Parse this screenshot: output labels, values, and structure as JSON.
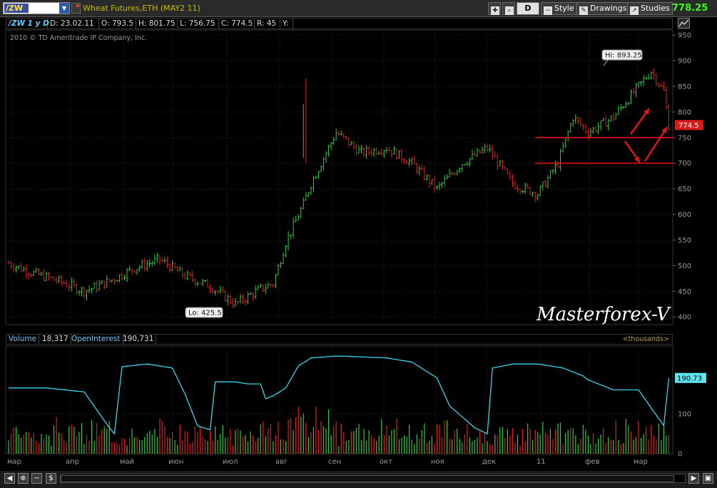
{
  "toolbar": {
    "symbol": "/ZW",
    "title": "Wheat Futures,ETH (MAY2 11)",
    "period_button": "D",
    "style_label": "Style",
    "drawings_label": "Drawings",
    "studies_label": "Studies",
    "last_price": "778.25"
  },
  "info_bar": {
    "symbol_period": "/ZW 1 y D",
    "date": "D: 23.02.11",
    "open": "O: 793.5",
    "high": "H: 801.75",
    "low": "L: 756.75",
    "close": "C: 774.5",
    "range": "R: 45",
    "y": "Y:"
  },
  "copyright": "2010 © TD Ameritrade IP Company, Inc.",
  "annotations": {
    "hi": "Hi: 893.25",
    "lo": "Lo: 425.5",
    "current_price_tag": "774.5",
    "watermark": "Masterforex-V"
  },
  "volume_bar": {
    "volume_label": "Volume",
    "volume_value": "18,317",
    "oi_label": "OpenInterest",
    "oi_value": "190,731",
    "units": "<thousands>"
  },
  "oi_tag": "190.73",
  "colors": {
    "up": "#2ecc40",
    "down": "#e02020",
    "oi_line": "#38d6e8",
    "axis_text": "#9a9a9a",
    "grid": "#2b2b2b"
  },
  "chart_data": [
    {
      "type": "candlestick",
      "title": "Wheat Futures,ETH (MAY2 11)",
      "xlabel": "",
      "ylabel": "",
      "x_ticks": [
        "мар",
        "апр",
        "май",
        "июн",
        "июл",
        "авг",
        "сен",
        "окт",
        "ноя",
        "дек",
        "11",
        "фев",
        "мар"
      ],
      "y_ticks": [
        400,
        450,
        500,
        550,
        600,
        650,
        700,
        750,
        800,
        850,
        900,
        950
      ],
      "ylim": [
        385,
        960
      ],
      "grid": true,
      "x_index": [
        0,
        10,
        20,
        30,
        40,
        50,
        60,
        70,
        80,
        90,
        100,
        105,
        110,
        117,
        120,
        130,
        140,
        150,
        160,
        170,
        180,
        190,
        200,
        210,
        218,
        224,
        230,
        240,
        250,
        255,
        260,
        262
      ],
      "close_path": [
        505,
        485,
        470,
        450,
        470,
        495,
        512,
        480,
        460,
        425,
        455,
        465,
        545,
        620,
        660,
        760,
        720,
        730,
        700,
        650,
        700,
        730,
        660,
        640,
        700,
        790,
        760,
        790,
        850,
        880,
        840,
        774.5
      ],
      "support_levels": [
        750,
        700
      ]
    },
    {
      "type": "bar+line",
      "series": [
        {
          "name": "Volume",
          "last": 18317
        },
        {
          "name": "OpenInterest",
          "last": 190731
        }
      ],
      "y_ticks": [
        0,
        100
      ],
      "ylim": [
        0,
        270
      ],
      "oi_x_index": [
        0,
        15,
        30,
        40,
        42,
        45,
        55,
        65,
        70,
        75,
        80,
        82,
        90,
        95,
        100,
        102,
        105,
        110,
        115,
        120,
        130,
        140,
        150,
        160,
        170,
        175,
        185,
        190,
        192,
        200,
        210,
        220,
        228,
        230,
        240,
        250,
        260,
        262
      ],
      "oi_values": [
        165,
        165,
        155,
        65,
        50,
        218,
        225,
        215,
        150,
        70,
        60,
        180,
        180,
        175,
        175,
        138,
        145,
        165,
        220,
        240,
        245,
        243,
        240,
        230,
        190,
        120,
        65,
        50,
        215,
        225,
        225,
        215,
        195,
        185,
        160,
        160,
        70,
        190
      ]
    }
  ]
}
